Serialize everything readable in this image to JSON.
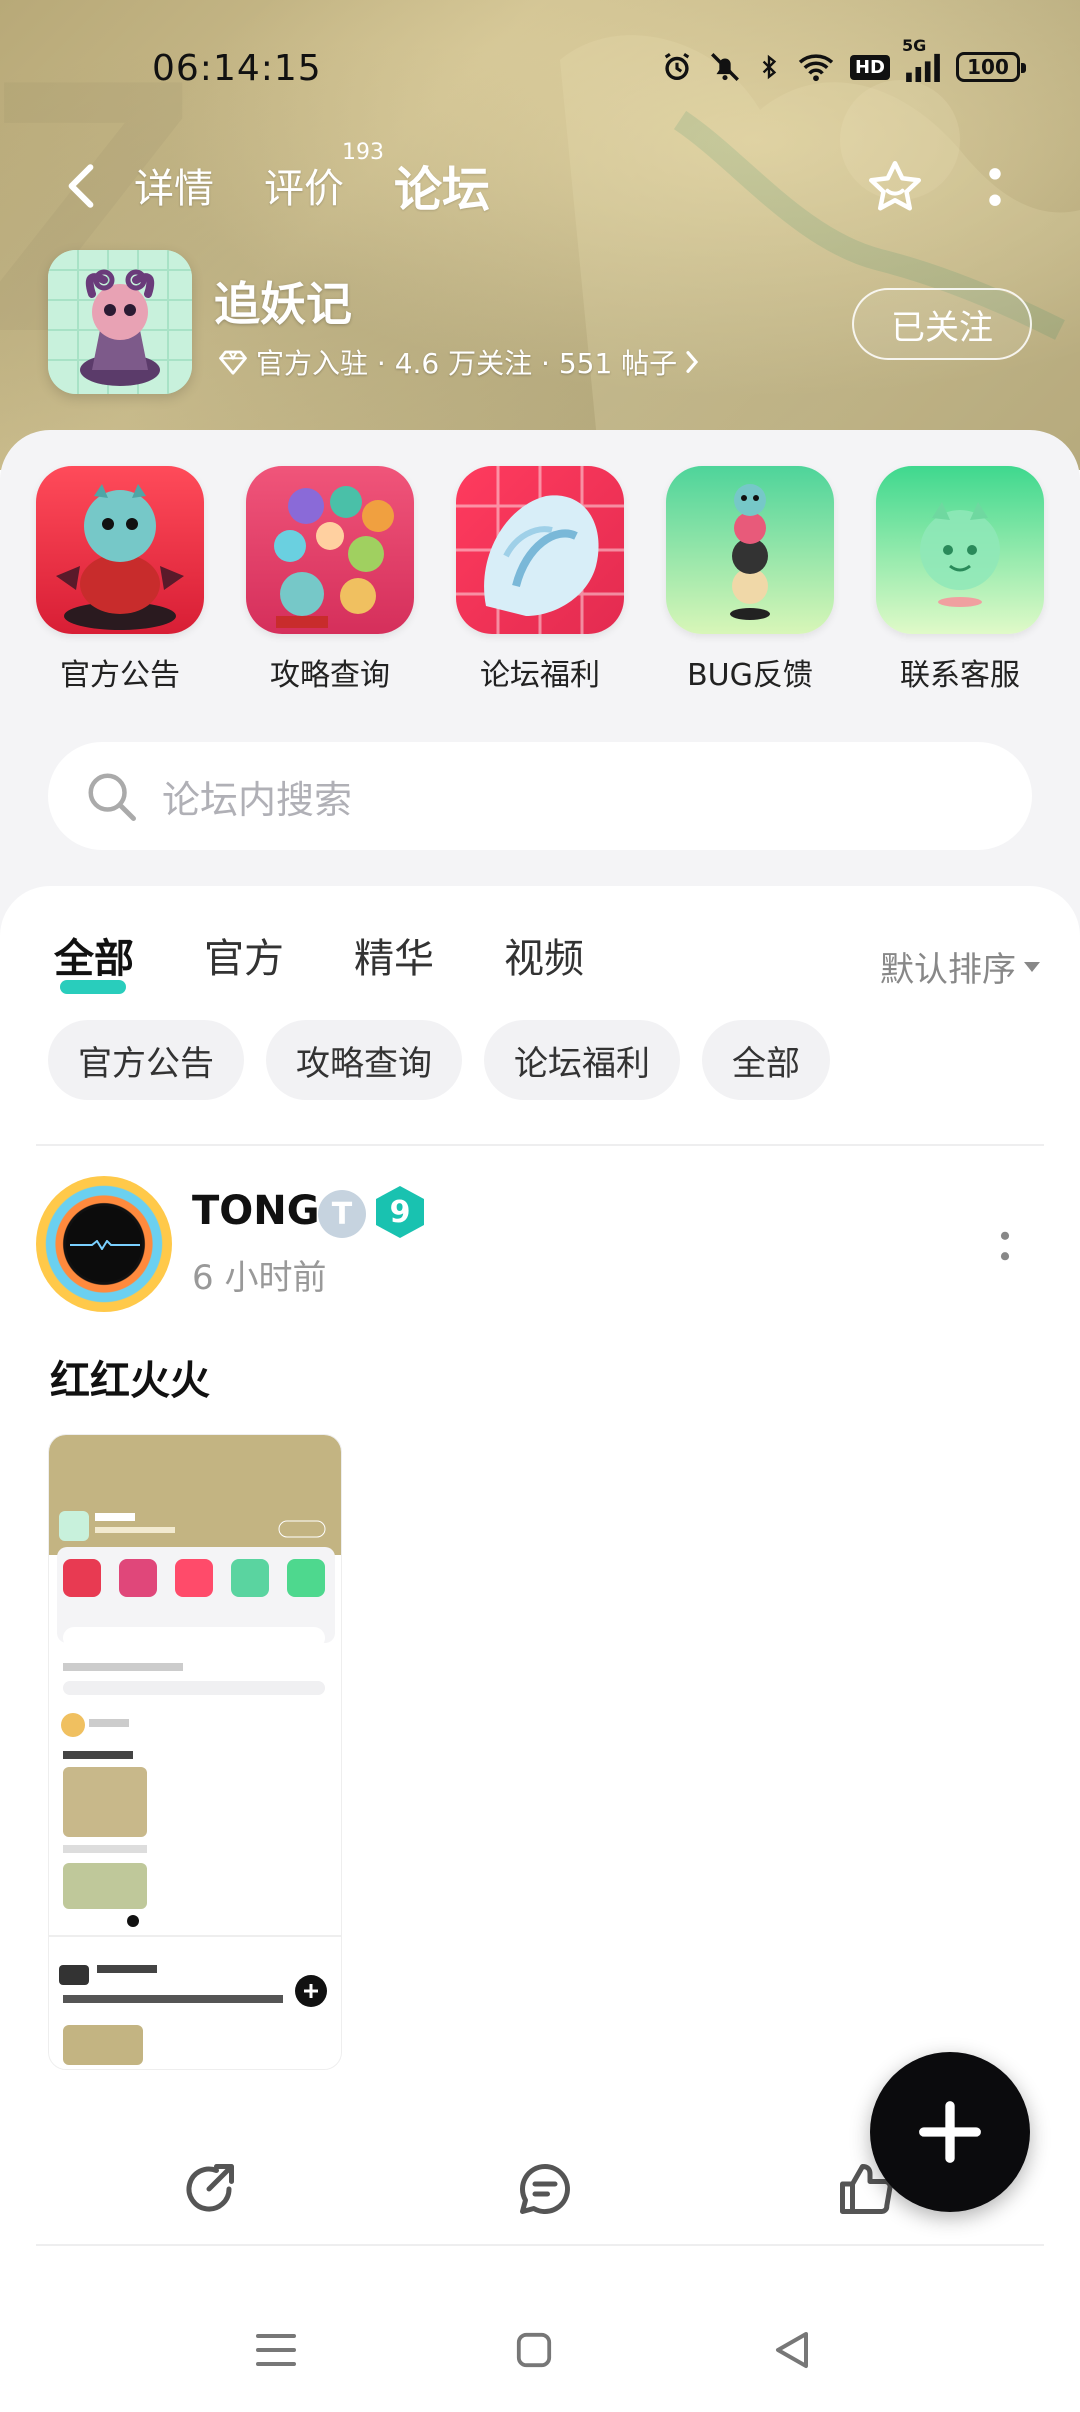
{
  "status_bar": {
    "time": "06:14:15",
    "network": "5G",
    "hd": "HD",
    "battery": "100"
  },
  "nav": {
    "tabs": [
      {
        "label": "详情"
      },
      {
        "label": "评价",
        "badge": "193"
      },
      {
        "label": "论坛",
        "active": true
      }
    ]
  },
  "game": {
    "name": "追妖记",
    "meta": "官方入驻 · 4.6 万关注 · 551 帖子",
    "follow_label": "已关注"
  },
  "shortcuts": [
    {
      "label": "官方公告"
    },
    {
      "label": "攻略查询"
    },
    {
      "label": "论坛福利"
    },
    {
      "label": "BUG反馈"
    },
    {
      "label": "联系客服"
    }
  ],
  "search": {
    "placeholder": "论坛内搜索"
  },
  "filters": [
    {
      "label": "全部",
      "active": true
    },
    {
      "label": "官方"
    },
    {
      "label": "精华"
    },
    {
      "label": "视频"
    }
  ],
  "sort_label": "默认排序",
  "chips": [
    {
      "label": "官方公告"
    },
    {
      "label": "攻略查询"
    },
    {
      "label": "论坛福利"
    },
    {
      "label": "全部"
    }
  ],
  "post": {
    "username": "TONG",
    "badge_level": "9",
    "time": "6 小时前",
    "title": "红红火火"
  },
  "colors": {
    "accent": "#12c8b5",
    "banner": "#c4b585"
  }
}
